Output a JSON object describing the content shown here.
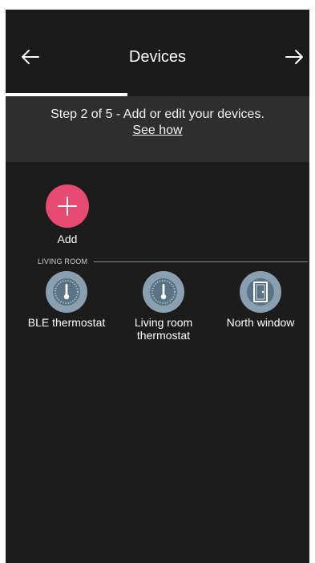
{
  "header": {
    "title": "Devices",
    "back_icon": "arrow-left-icon",
    "next_icon": "arrow-right-icon"
  },
  "progress": {
    "step": 2,
    "total": 5,
    "fraction": 0.4
  },
  "banner": {
    "text": "Step 2 of 5 - Add or edit your devices.",
    "link": "See how"
  },
  "add": {
    "label": "Add",
    "icon": "plus-icon",
    "color": "#e84b72"
  },
  "section": {
    "label": "LIVING ROOM"
  },
  "devices": [
    {
      "name": "BLE thermostat",
      "icon": "thermostat-icon"
    },
    {
      "name": "Living room thermostat",
      "icon": "thermostat-icon"
    },
    {
      "name": "North window",
      "icon": "window-contact-icon"
    }
  ],
  "colors": {
    "background": "#1c1c1c",
    "banner": "#2e2e2e",
    "device_ring": "#8aa0b0"
  }
}
